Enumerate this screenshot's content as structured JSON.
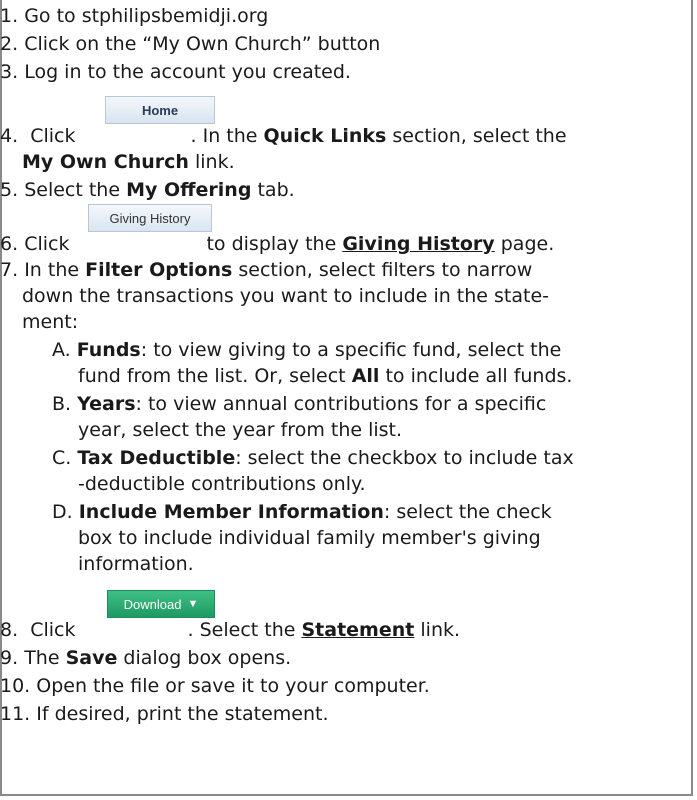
{
  "steps": [
    {
      "n": "1.",
      "text": "Go to stphilipsbemidji.org"
    },
    {
      "n": "2.",
      "text": "Click on the “My Own Church” button"
    },
    {
      "n": "3.",
      "text": "Log in to the account you created."
    },
    {
      "n": "4.",
      "pre": "Click",
      "post": ". In the",
      "bold1": "Quick Links",
      "post2": "section, select the",
      "line2_bold": "My Own Church",
      "line2_rest": "link."
    },
    {
      "n": "5.",
      "pre": "Select the",
      "bold": "My Offering",
      "post": "tab."
    },
    {
      "n": "6.",
      "pre": "Click",
      "post": "to display the",
      "bold_u": "Giving History",
      "post2": "page."
    },
    {
      "n": "7.",
      "pre": "In the",
      "bold": "Filter Options",
      "post": "section, select filters to narrow",
      "line2": "down the transactions you want to include in the state-",
      "line3": "ment:"
    },
    {
      "n": "8.",
      "pre": "Click",
      "post": ". Select the",
      "bold_u": "Statement",
      "post2": "link."
    },
    {
      "n": "9.",
      "pre": "The",
      "bold": "Save",
      "post": "dialog box opens."
    },
    {
      "n": "10.",
      "text": "Open the file or save it to your computer."
    },
    {
      "n": "11.",
      "text": "If desired, print the statement."
    }
  ],
  "substeps": [
    {
      "n": "A.",
      "bold": "Funds",
      "l1": ": to view giving to a specific fund, select the",
      "l2pre": "fund from the list. Or, select",
      "l2bold": "All",
      "l2post": "to include all funds."
    },
    {
      "n": "B.",
      "bold": "Years",
      "l1": ": to view annual contributions for a specific",
      "l2": "year, select the year from the list."
    },
    {
      "n": "C.",
      "bold": "Tax Deductible",
      "l1": ": select the checkbox to include tax",
      "l2": "-deductible contributions only."
    },
    {
      "n": "D.",
      "bold": "Include Member Information",
      "l1": ": select the check",
      "l2": "box to include individual family member's giving",
      "l3": "information."
    }
  ],
  "buttons": {
    "home": "Home",
    "giving_history": "Giving History",
    "download": "Download",
    "download_icon": "caret-down-icon"
  }
}
